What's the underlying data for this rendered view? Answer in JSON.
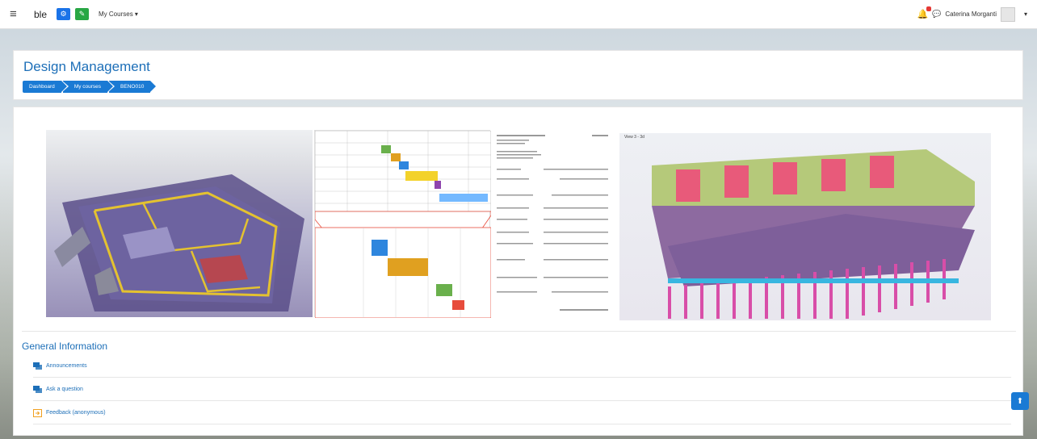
{
  "navbar": {
    "brand": "ble",
    "my_courses": "My Courses ▾",
    "user_name": "Caterina Morganti",
    "user_menu_caret": "▾"
  },
  "header": {
    "title": "Design Management",
    "breadcrumb": [
      "Dashboard",
      "My courses",
      "BENO010"
    ]
  },
  "main": {
    "section_title": "General Information",
    "activities": [
      {
        "label": "Announcements",
        "icon": "forum-icon"
      },
      {
        "label": "Ask a question",
        "icon": "forum-icon"
      },
      {
        "label": "Feedback (anonymous)",
        "icon": "feedback-icon"
      }
    ],
    "image_view_label": "View 3 - 3d"
  },
  "colors": {
    "accent": "#1a7ad4",
    "title": "#1d6fb8",
    "green_button": "#28a745"
  }
}
